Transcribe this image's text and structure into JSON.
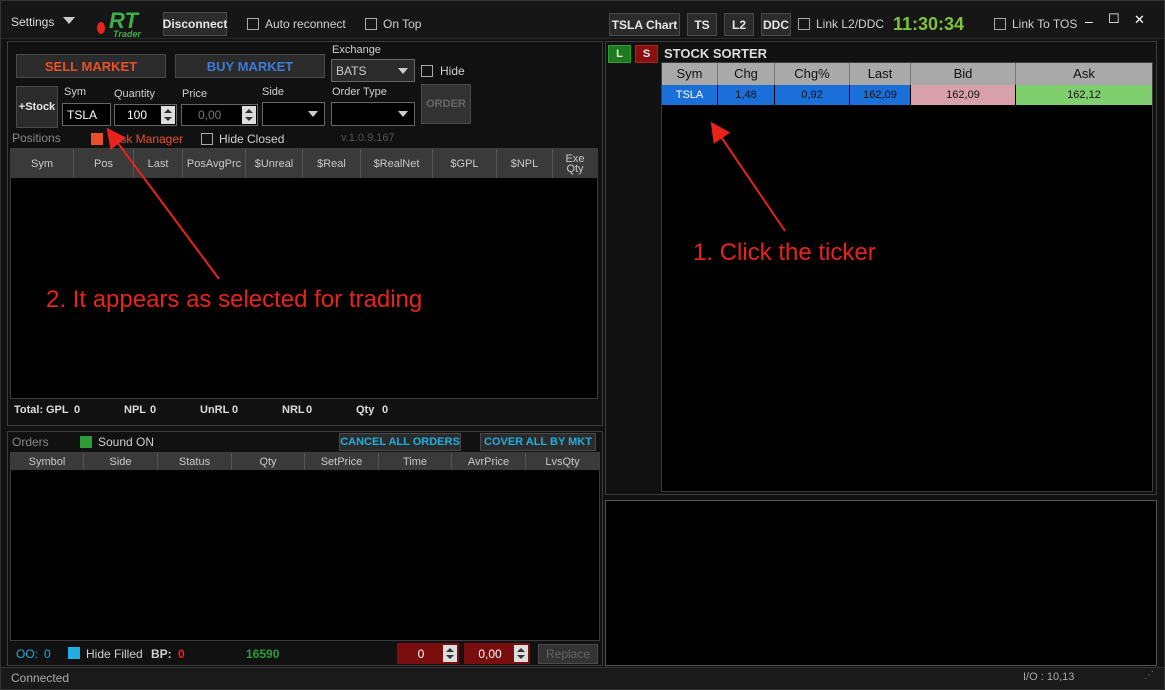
{
  "topbar": {
    "settings": "Settings",
    "logo": "RT",
    "logo_sub": "Trader",
    "disconnect": "Disconnect",
    "auto_reconnect": "Auto reconnect",
    "on_top": "On Top",
    "chart_btn": "TSLA Chart",
    "ts_btn": "TS",
    "l2_btn": "L2",
    "ddc_btn": "DDC",
    "link_l2": "Link L2/DDC",
    "clock": "11:30:34",
    "link_tos": "Link To TOS",
    "min": "–",
    "max": "☐",
    "close": "✕"
  },
  "trade": {
    "sell": "SELL MARKET",
    "buy": "BUY MARKET",
    "exchange_label": "Exchange",
    "exchange": "BATS",
    "hide": "Hide",
    "add_stock": "+Stock",
    "sym_label": "Sym",
    "sym": "TSLA",
    "qty_label": "Quantity",
    "qty": "100",
    "price_label": "Price",
    "price": "0,00",
    "side_label": "Side",
    "ordertype_label": "Order Type",
    "order_btn": "ORDER"
  },
  "positions": {
    "label": "Positions",
    "risk": "Risk Manager",
    "hide_closed": "Hide Closed",
    "version": "v.1.0.9.167",
    "columns": [
      "Sym",
      "Pos",
      "Last",
      "PosAvgPrc",
      "$Unreal",
      "$Real",
      "$RealNet",
      "$GPL",
      "$NPL",
      "Exe Qty"
    ],
    "totals": {
      "total": "Total:",
      "gpl_l": "GPL",
      "gpl": "0",
      "npl_l": "NPL",
      "npl": "0",
      "unrl_l": "UnRL",
      "unrl": "0",
      "nrl_l": "NRL",
      "nrl": "0",
      "qty_l": "Qty",
      "qty": "0"
    }
  },
  "orders": {
    "label": "Orders",
    "sound": "Sound ON",
    "cancel_all": "CANCEL ALL ORDERS",
    "cover_all": "COVER ALL BY MKT",
    "columns": [
      "Symbol",
      "Side",
      "Status",
      "Qty",
      "SetPrice",
      "Time",
      "AvrPrice",
      "LvsQty"
    ],
    "oo_label": "OO:",
    "oo": "0",
    "hide_filled": "Hide Filled",
    "bp_label": "BP:",
    "bp": "0",
    "bp_value": "16590",
    "spin1": "0",
    "spin2": "0,00",
    "replace": "Replace"
  },
  "sorter": {
    "l": "L",
    "s": "S",
    "title": "STOCK SORTER",
    "columns": [
      "Sym",
      "Chg",
      "Chg%",
      "Last",
      "Bid",
      "Ask"
    ],
    "row": {
      "sym": "TSLA",
      "chg": "1,48",
      "chgp": "0,92",
      "last": "162,09",
      "bid": "162,09",
      "ask": "162,12"
    }
  },
  "status": {
    "connected": "Connected",
    "io": "I/O : 10,13"
  },
  "annotations": {
    "a1": "1. Click the ticker",
    "a2": "2. It appears as selected for trading"
  },
  "colors": {
    "sell": "#e8502b",
    "buy": "#3d7bd6",
    "clock": "#7ec43a",
    "annot": "#e8231c",
    "row_sel": "#1a6fd8",
    "bid": "#d8a0aa",
    "ask": "#7fcf6f"
  }
}
